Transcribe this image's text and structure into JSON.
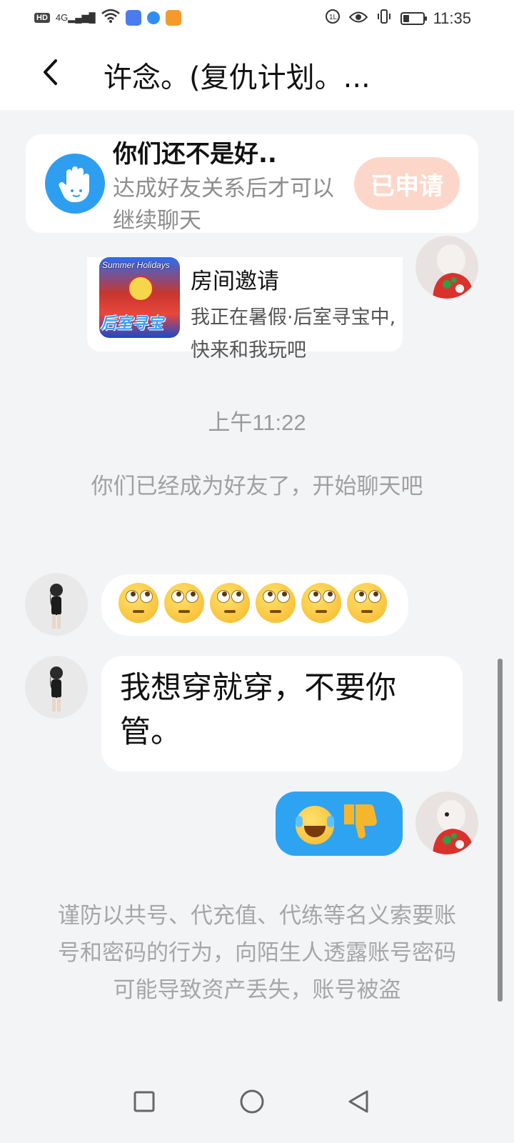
{
  "status_bar": {
    "hd": "HD",
    "network": "4G",
    "time": "11:35"
  },
  "header": {
    "title": "许念。(复仇计划。..."
  },
  "friend_card": {
    "title": "你们还不是好..",
    "subtitle": "达成好友关系后才可以继续聊天",
    "button_label": "已申请"
  },
  "invite_card": {
    "banner": "Summer Holidays",
    "game_name": "后室寻宝",
    "title": "房间邀请",
    "description": "我正在暑假·后室寻宝中, 快来和我玩吧"
  },
  "timestamp": "上午11:22",
  "system_message": "你们已经成为好友了，开始聊天吧",
  "messages": [
    {
      "sender": "other",
      "type": "emoji",
      "emoji": "face-with-rolling-eyes",
      "count": 6
    },
    {
      "sender": "other",
      "type": "text",
      "text": "我想穿就穿，不要你管。"
    },
    {
      "sender": "self",
      "type": "emoji",
      "emojis": [
        "face-with-tears-of-joy",
        "thumbs-down"
      ]
    }
  ],
  "warning": "谨防以共号、代充值、代练等名义索要账号和密码的行为，向陌生人透露账号密码可能导致资产丢失，账号被盗",
  "colors": {
    "accent_blue": "#2ea3f2",
    "applied_button": "#fcd7c9",
    "background": "#f3f4f6"
  }
}
